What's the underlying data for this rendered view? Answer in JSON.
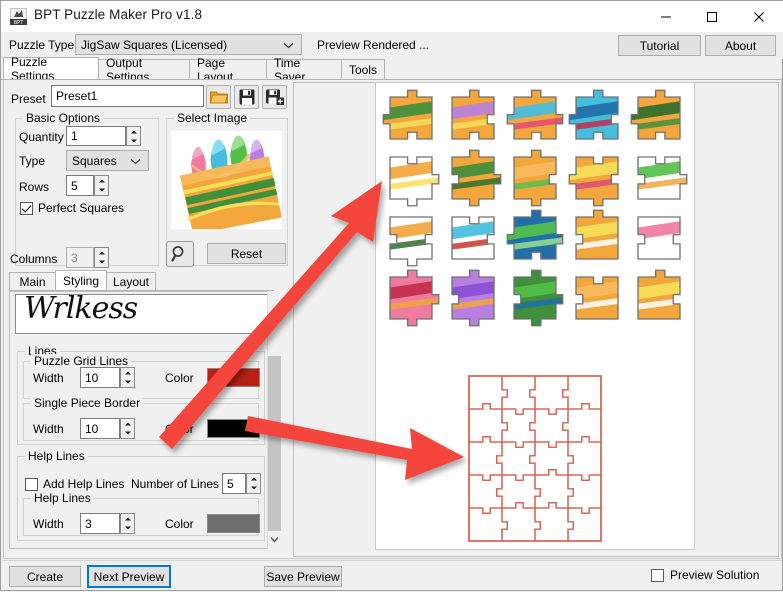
{
  "window": {
    "title": "BPT Puzzle Maker Pro v1.8",
    "app_icon": "bpt-app-icon",
    "minimize": "minimize-icon",
    "maximize": "maximize-icon",
    "close": "close-icon"
  },
  "toolbar": {
    "puzzle_type_label": "Puzzle Type",
    "puzzle_type_value": "JigSaw Squares (Licensed)",
    "status_text": "Preview Rendered ...",
    "tutorial_label": "Tutorial",
    "about_label": "About"
  },
  "main_tabs": [
    {
      "label": "Puzzle Settings",
      "selected": true
    },
    {
      "label": "Output Settings",
      "selected": false
    },
    {
      "label": "Page Layout",
      "selected": false
    },
    {
      "label": "Time Saver",
      "selected": false
    },
    {
      "label": "Tools",
      "selected": false
    }
  ],
  "preset": {
    "label": "Preset",
    "value": "Preset1",
    "open_icon": "folder-open-icon",
    "save_icon": "floppy-save-icon",
    "save_as_icon": "floppy-save-as-icon"
  },
  "basic_options": {
    "legend": "Basic Options",
    "quantity_label": "Quantity",
    "quantity_value": "1",
    "type_label": "Type",
    "type_value": "Squares",
    "rows_label": "Rows",
    "rows_value": "5",
    "perfect_squares_label": "Perfect Squares",
    "perfect_squares_checked": true,
    "columns_label": "Columns",
    "columns_value": "3",
    "columns_disabled": true
  },
  "select_image": {
    "legend": "Select Image",
    "zoom_icon": "magnifier-icon",
    "reset_label": "Reset",
    "thumbnail_name": "crayon-box-image-thumbnail"
  },
  "sub_tabs": [
    {
      "label": "Main",
      "selected": false
    },
    {
      "label": "Styling",
      "selected": true
    },
    {
      "label": "Layout",
      "selected": false
    }
  ],
  "styling": {
    "font_preview_text": "Wrlkess",
    "lines_legend": "Lines",
    "grid_lines_legend": "Puzzle Grid Lines",
    "grid_width_label": "Width",
    "grid_width_value": "10",
    "grid_color_label": "Color",
    "grid_color_value": "#b72113",
    "piece_border_legend": "Single Piece Border",
    "border_width_label": "Width",
    "border_width_value": "10",
    "border_color_label": "Color",
    "border_color_value": "#000000",
    "help_lines_legend": "Help Lines",
    "add_help_lines_label": "Add Help Lines",
    "add_help_lines_checked": false,
    "number_of_lines_label": "Number of Lines",
    "number_of_lines_value": "5",
    "help_lines_sub_legend": "Help Lines",
    "help_width_label": "Width",
    "help_width_value": "3",
    "help_color_label": "Color",
    "help_color_value": "#6e6e6e"
  },
  "preview": {
    "pieces_rows": 4,
    "pieces_cols": 5,
    "solution_grid_rows": 5,
    "solution_grid_cols": 4,
    "solution_line_color": "#d9604f"
  },
  "bottom": {
    "create_label": "Create",
    "next_preview_label": "Next Preview",
    "save_preview_label": "Save Preview",
    "preview_solution_label": "Preview Solution",
    "preview_solution_checked": false
  },
  "annotations": {
    "arrow_color": "#f4453c",
    "arrow_1_name": "arrow-grid-color-to-pieces",
    "arrow_2_name": "arrow-border-color-to-solution"
  }
}
